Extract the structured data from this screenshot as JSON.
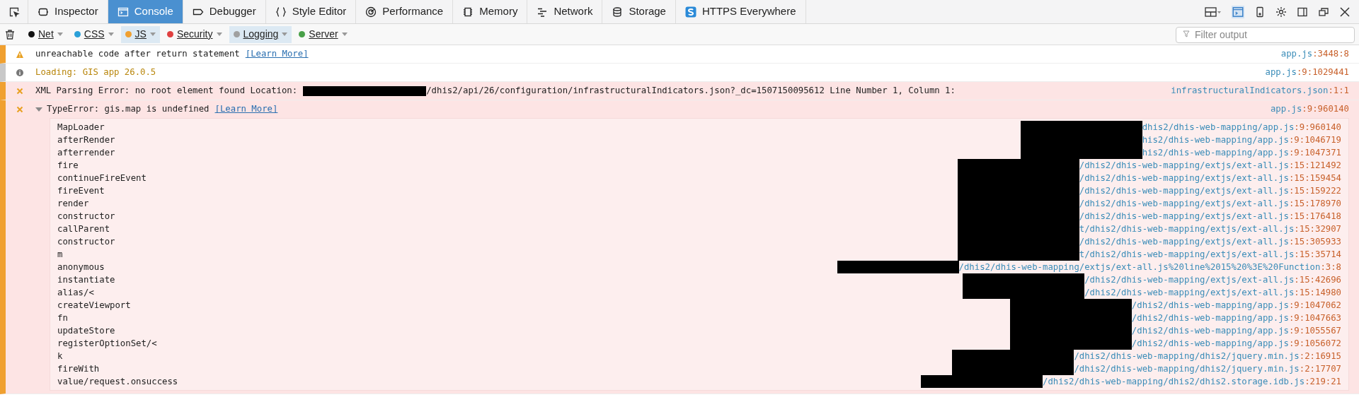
{
  "toolbar": {
    "tabs": [
      {
        "label": "Inspector",
        "kind": "inspector",
        "selected": false
      },
      {
        "label": "Console",
        "kind": "console",
        "selected": true
      },
      {
        "label": "Debugger",
        "kind": "debugger",
        "selected": false
      },
      {
        "label": "Style Editor",
        "kind": "style",
        "selected": false
      },
      {
        "label": "Performance",
        "kind": "performance",
        "selected": false
      },
      {
        "label": "Memory",
        "kind": "memory",
        "selected": false
      },
      {
        "label": "Network",
        "kind": "network",
        "selected": false
      },
      {
        "label": "Storage",
        "kind": "storage",
        "selected": false
      },
      {
        "label": "HTTPS Everywhere",
        "kind": "https",
        "selected": false
      }
    ]
  },
  "filters": {
    "items": [
      {
        "label": "Net",
        "color": "#111111",
        "selected": false
      },
      {
        "label": "CSS",
        "color": "#2ba0d8",
        "selected": false
      },
      {
        "label": "JS",
        "color": "#f0a030",
        "selected": true
      },
      {
        "label": "Security",
        "color": "#e04040",
        "selected": false
      },
      {
        "label": "Logging",
        "color": "#a0a0a0",
        "selected": true
      },
      {
        "label": "Server",
        "color": "#48a048",
        "selected": false
      }
    ],
    "search": {
      "placeholder": "Filter output"
    }
  },
  "messages": [
    {
      "kind": "warning",
      "text": "unreachable code after return statement",
      "link": "[Learn More]",
      "source": "app.js",
      "loc": ":3448:8"
    },
    {
      "kind": "info",
      "text": "Loading: GIS app 26.0.5",
      "source": "app.js",
      "loc": ":9:1029441"
    },
    {
      "kind": "error",
      "text": "XML Parsing Error: no root element found Location:",
      "redacted": true,
      "text_after": "/dhis2/api/26/configuration/infrastructuralIndicators.json?_dc=1507150095612 Line Number 1, Column 1:",
      "source": "infrastructuralIndicators.json",
      "loc": ":1:1"
    },
    {
      "kind": "error",
      "expanded": true,
      "text": "TypeError: gis.map is undefined",
      "link": "[Learn More]",
      "source": "app.js",
      "loc": ":9:960140",
      "stack": [
        {
          "fn": "MapLoader",
          "path": "dhis2/dhis-web-mapping/app.js",
          "loc": ":9:960140"
        },
        {
          "fn": "afterRender",
          "path": "his2/dhis-web-mapping/app.js",
          "loc": ":9:1046719"
        },
        {
          "fn": "afterrender",
          "path": "his2/dhis-web-mapping/app.js",
          "loc": ":9:1047371"
        },
        {
          "fn": "fire",
          "path": "/dhis2/dhis-web-mapping/extjs/ext-all.js",
          "loc": ":15:121492"
        },
        {
          "fn": "continueFireEvent",
          "path": "/dhis2/dhis-web-mapping/extjs/ext-all.js",
          "loc": ":15:159454"
        },
        {
          "fn": "fireEvent",
          "path": "/dhis2/dhis-web-mapping/extjs/ext-all.js",
          "loc": ":15:159222"
        },
        {
          "fn": "render",
          "path": "/dhis2/dhis-web-mapping/extjs/ext-all.js",
          "loc": ":15:178970"
        },
        {
          "fn": "constructor",
          "path": "/dhis2/dhis-web-mapping/extjs/ext-all.js",
          "loc": ":15:176418"
        },
        {
          "fn": "callParent",
          "path": "t/dhis2/dhis-web-mapping/extjs/ext-all.js",
          "loc": ":15:32907"
        },
        {
          "fn": "constructor",
          "path": "/dhis2/dhis-web-mapping/extjs/ext-all.js",
          "loc": ":15:305933"
        },
        {
          "fn": "m",
          "path": "t/dhis2/dhis-web-mapping/extjs/ext-all.js",
          "loc": ":15:35714"
        },
        {
          "fn": "anonymous",
          "path": "/dhis2/dhis-web-mapping/extjs/ext-all.js%20line%2015%20%3E%20Function",
          "loc": ":3:8"
        },
        {
          "fn": "instantiate",
          "path": "/dhis2/dhis-web-mapping/extjs/ext-all.js",
          "loc": ":15:42696"
        },
        {
          "fn": "alias/<",
          "path": "/dhis2/dhis-web-mapping/extjs/ext-all.js",
          "loc": ":15:14980"
        },
        {
          "fn": "createViewport",
          "path": "/dhis2/dhis-web-mapping/app.js",
          "loc": ":9:1047062"
        },
        {
          "fn": "fn",
          "path": "/dhis2/dhis-web-mapping/app.js",
          "loc": ":9:1047663"
        },
        {
          "fn": "updateStore",
          "path": "/dhis2/dhis-web-mapping/app.js",
          "loc": ":9:1055567"
        },
        {
          "fn": "registerOptionSet/<",
          "path": "/dhis2/dhis-web-mapping/app.js",
          "loc": ":9:1056072"
        },
        {
          "fn": "k",
          "path": "/dhis2/dhis-web-mapping/dhis2/jquery.min.js",
          "loc": ":2:16915"
        },
        {
          "fn": "fireWith",
          "path": "/dhis2/dhis-web-mapping/dhis2/jquery.min.js",
          "loc": ":2:17707"
        },
        {
          "fn": "value/request.onsuccess",
          "path": "/dhis2/dhis-web-mapping/dhis2/dhis2.storage.idb.js",
          "loc": ":219:21"
        }
      ]
    }
  ]
}
